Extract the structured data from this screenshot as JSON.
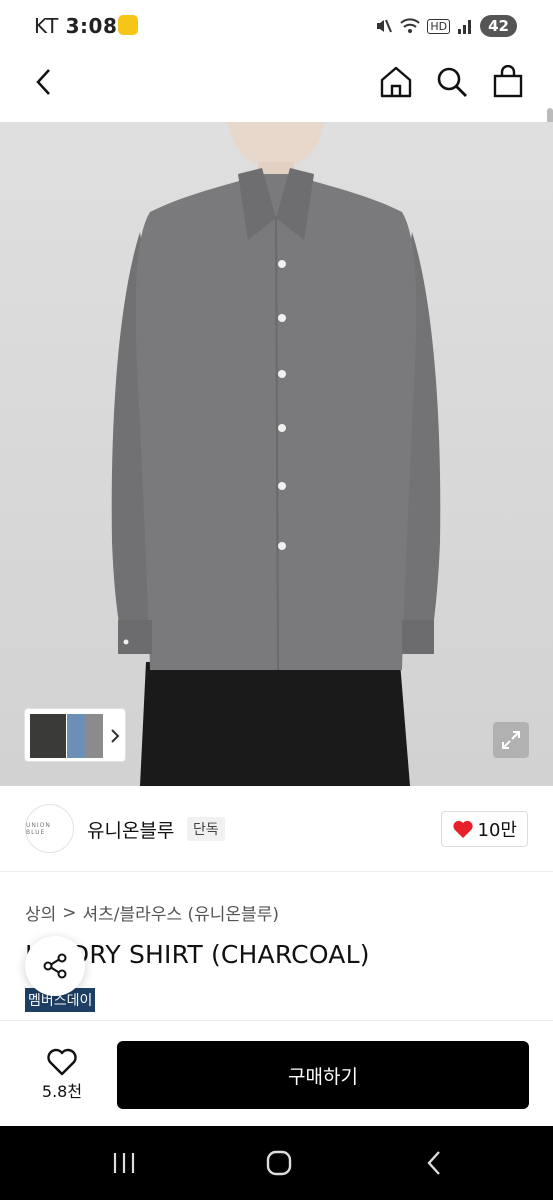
{
  "status_bar": {
    "carrier": "KT",
    "time": "3:08",
    "network_label": "HD",
    "battery": "42"
  },
  "brand": {
    "logo_text": "UNION BLUE",
    "name": "유니온블루",
    "badge": "단독",
    "likes": "10만"
  },
  "breadcrumb": {
    "category": "상의",
    "separator": ">",
    "subcategory": "셔츠/블라우스 (유니온블루)"
  },
  "product": {
    "title_visible": "NDRY SHIRT (CHARCOAL)",
    "title_partial": "L",
    "event_tag": "멤버스데이"
  },
  "actions": {
    "wish_count": "5.8천",
    "buy_label": "구매하기"
  },
  "colors": {
    "like_heart": "#e8202a",
    "event_tag_bg": "#1d3f63",
    "buy_button_bg": "#000000",
    "shirt": "#7a7a7c"
  }
}
